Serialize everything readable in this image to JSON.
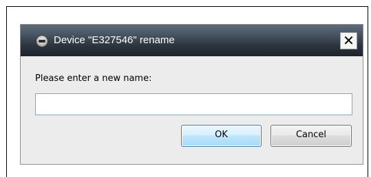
{
  "dialog": {
    "title": "Device \"E327546\" rename",
    "title_icon": "device-icon",
    "close_label": "✕",
    "prompt_label": "Please enter a new name:",
    "name_input": {
      "value": "",
      "placeholder": ""
    },
    "ok_label": "OK",
    "cancel_label": "Cancel"
  },
  "colors": {
    "titlebar_top": "#5e6b79",
    "titlebar_bottom": "#1d232b",
    "dialog_body": "#ececec",
    "ok_border": "#3c7fb1",
    "input_border": "#8aa3bd"
  }
}
